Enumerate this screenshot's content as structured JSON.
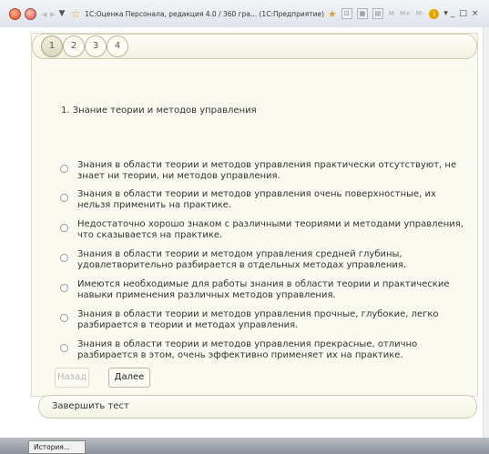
{
  "window": {
    "title": "1С:Оценка Персонала, редакция 4.0 / 360 гра... (1С:Предприятие)",
    "m_buttons": [
      "M",
      "M+",
      "M-"
    ]
  },
  "tabs": [
    {
      "label": "1",
      "active": true
    },
    {
      "label": "2",
      "active": false
    },
    {
      "label": "3",
      "active": false
    },
    {
      "label": "4",
      "active": false
    }
  ],
  "question": "1. Знание теории и методов управления",
  "options": [
    {
      "text": "Знания в области теории и методов управления практически отсутствуют, не знает ни теории, ни методов управления."
    },
    {
      "text": "Знания в области теории и методов управления очень поверхностные, их нельзя применить на практике."
    },
    {
      "text": "Недостаточно хорошо знаком с различными теориями и методами управления, что сказывается на практике."
    },
    {
      "text": "Знания в области теории и методом управления средней глубины, удовлетворительно разбирается в отдельных методах управления."
    },
    {
      "text": "Имеются необходимые для работы знания в области теории и практические навыки применения различных методов управления."
    },
    {
      "text": "Знания в области теории и методов управления прочные, глубокие, легко разбирается в теории и методах управления."
    },
    {
      "text": "Знания в области теории и методов управления прекрасные, отлично разбирается в этом, очень эффективно применяет их на практике."
    }
  ],
  "nav": {
    "back": "Назад",
    "next": "Далее"
  },
  "finish": "Завершить тест",
  "statusbar": {
    "history": "История..."
  },
  "colors": {
    "panel_bg": "#fafaf0",
    "panel_border": "#cfccb4",
    "titlebar_bg": "#e6eaef"
  }
}
